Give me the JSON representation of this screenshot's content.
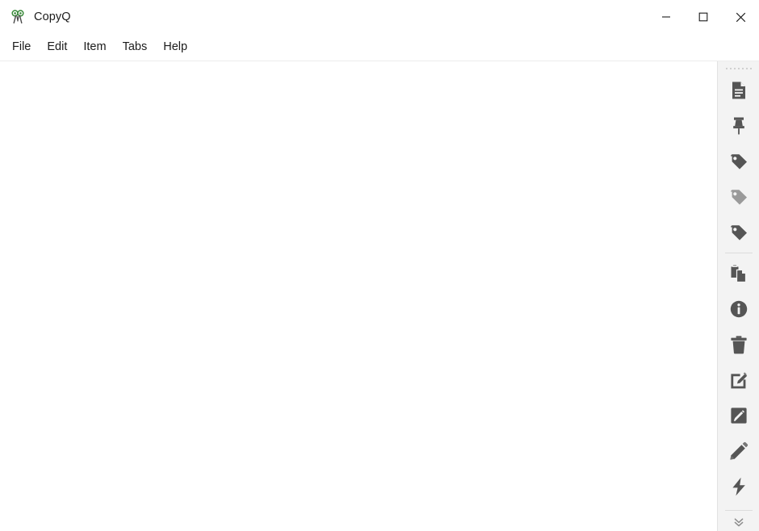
{
  "window": {
    "title": "CopyQ",
    "app_icon": "copyq-scissors-icon",
    "accent_color": "#3a8a3a",
    "titlebar_bg": "#ffffff",
    "toolbar_bg": "#f3f3f3",
    "icon_color": "#555555",
    "icon_color_disabled": "#9a9a9a",
    "controls": [
      {
        "name": "minimize-button",
        "icon": "minimize-icon",
        "label": "Minimize"
      },
      {
        "name": "maximize-button",
        "icon": "maximize-icon",
        "label": "Maximize"
      },
      {
        "name": "close-button",
        "icon": "close-icon",
        "label": "Close"
      }
    ]
  },
  "menubar": {
    "items": [
      {
        "label": "File",
        "name": "menu-file"
      },
      {
        "label": "Edit",
        "name": "menu-edit"
      },
      {
        "label": "Item",
        "name": "menu-item"
      },
      {
        "label": "Tabs",
        "name": "menu-tabs"
      },
      {
        "label": "Help",
        "name": "menu-help"
      }
    ]
  },
  "content": {
    "empty": true,
    "text": ""
  },
  "toolbar": {
    "handle": "drag-handle",
    "overflow": "toolbar-overflow-chevron",
    "items": [
      {
        "name": "new-item-button",
        "icon": "document-icon",
        "state": "enabled"
      },
      {
        "name": "pin-item-button",
        "icon": "pin-icon",
        "state": "enabled"
      },
      {
        "name": "tag-add-button",
        "icon": "tag-icon",
        "state": "enabled"
      },
      {
        "name": "tag-remove-button",
        "icon": "tag-icon",
        "state": "disabled"
      },
      {
        "name": "tag-edit-button",
        "icon": "tag-icon",
        "state": "enabled"
      },
      {
        "name": "separator-1",
        "icon": "separator",
        "state": "static"
      },
      {
        "name": "paste-item-button",
        "icon": "paste-icon",
        "state": "enabled"
      },
      {
        "name": "item-info-button",
        "icon": "info-icon",
        "state": "enabled"
      },
      {
        "name": "remove-item-button",
        "icon": "trash-icon",
        "state": "enabled"
      },
      {
        "name": "edit-item-button",
        "icon": "edit-box-pen-icon",
        "state": "enabled"
      },
      {
        "name": "edit-notes-button",
        "icon": "edit-square-icon",
        "state": "enabled"
      },
      {
        "name": "edit-content-button",
        "icon": "pencil-icon",
        "state": "enabled"
      },
      {
        "name": "run-command-button",
        "icon": "lightning-icon",
        "state": "enabled"
      },
      {
        "name": "separator-2",
        "icon": "separator",
        "state": "static"
      }
    ]
  }
}
